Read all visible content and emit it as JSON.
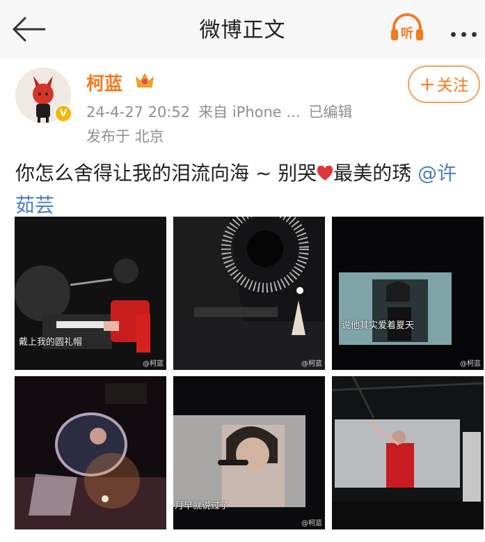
{
  "header": {
    "title": "微博正文"
  },
  "user": {
    "name": "柯蓝",
    "verified_mark": "V"
  },
  "post": {
    "date": "24-4-27 20:52",
    "source": "来自 iPhone ...",
    "edited": "已编辑",
    "location": "发布于 北京",
    "text_before": "你怎么舍得让我的泪流向海 ~ 别哭",
    "text_after": "最美的琇 ",
    "mention": "@许茹芸"
  },
  "follow": {
    "plus": "+",
    "label": "关注"
  },
  "images": [
    {
      "caption": "戴上我的圆礼帽",
      "watermark": "@柯蓝"
    },
    {
      "caption": "",
      "watermark": "@柯蓝"
    },
    {
      "caption": "说他其实爱着夏天",
      "watermark": "@柯蓝"
    },
    {
      "caption": "",
      "watermark": ""
    },
    {
      "caption": "月早就说过了",
      "watermark": "@柯蓝"
    },
    {
      "caption": "",
      "watermark": ""
    }
  ],
  "colors": {
    "accent": "#f47a1f",
    "link": "#4a7cc7",
    "meta": "#8f8f8f",
    "verified": "#f7b500"
  },
  "icons": [
    "back-arrow-icon",
    "listen-icon",
    "more-icon",
    "crown-icon",
    "verified-icon",
    "heart-icon"
  ]
}
